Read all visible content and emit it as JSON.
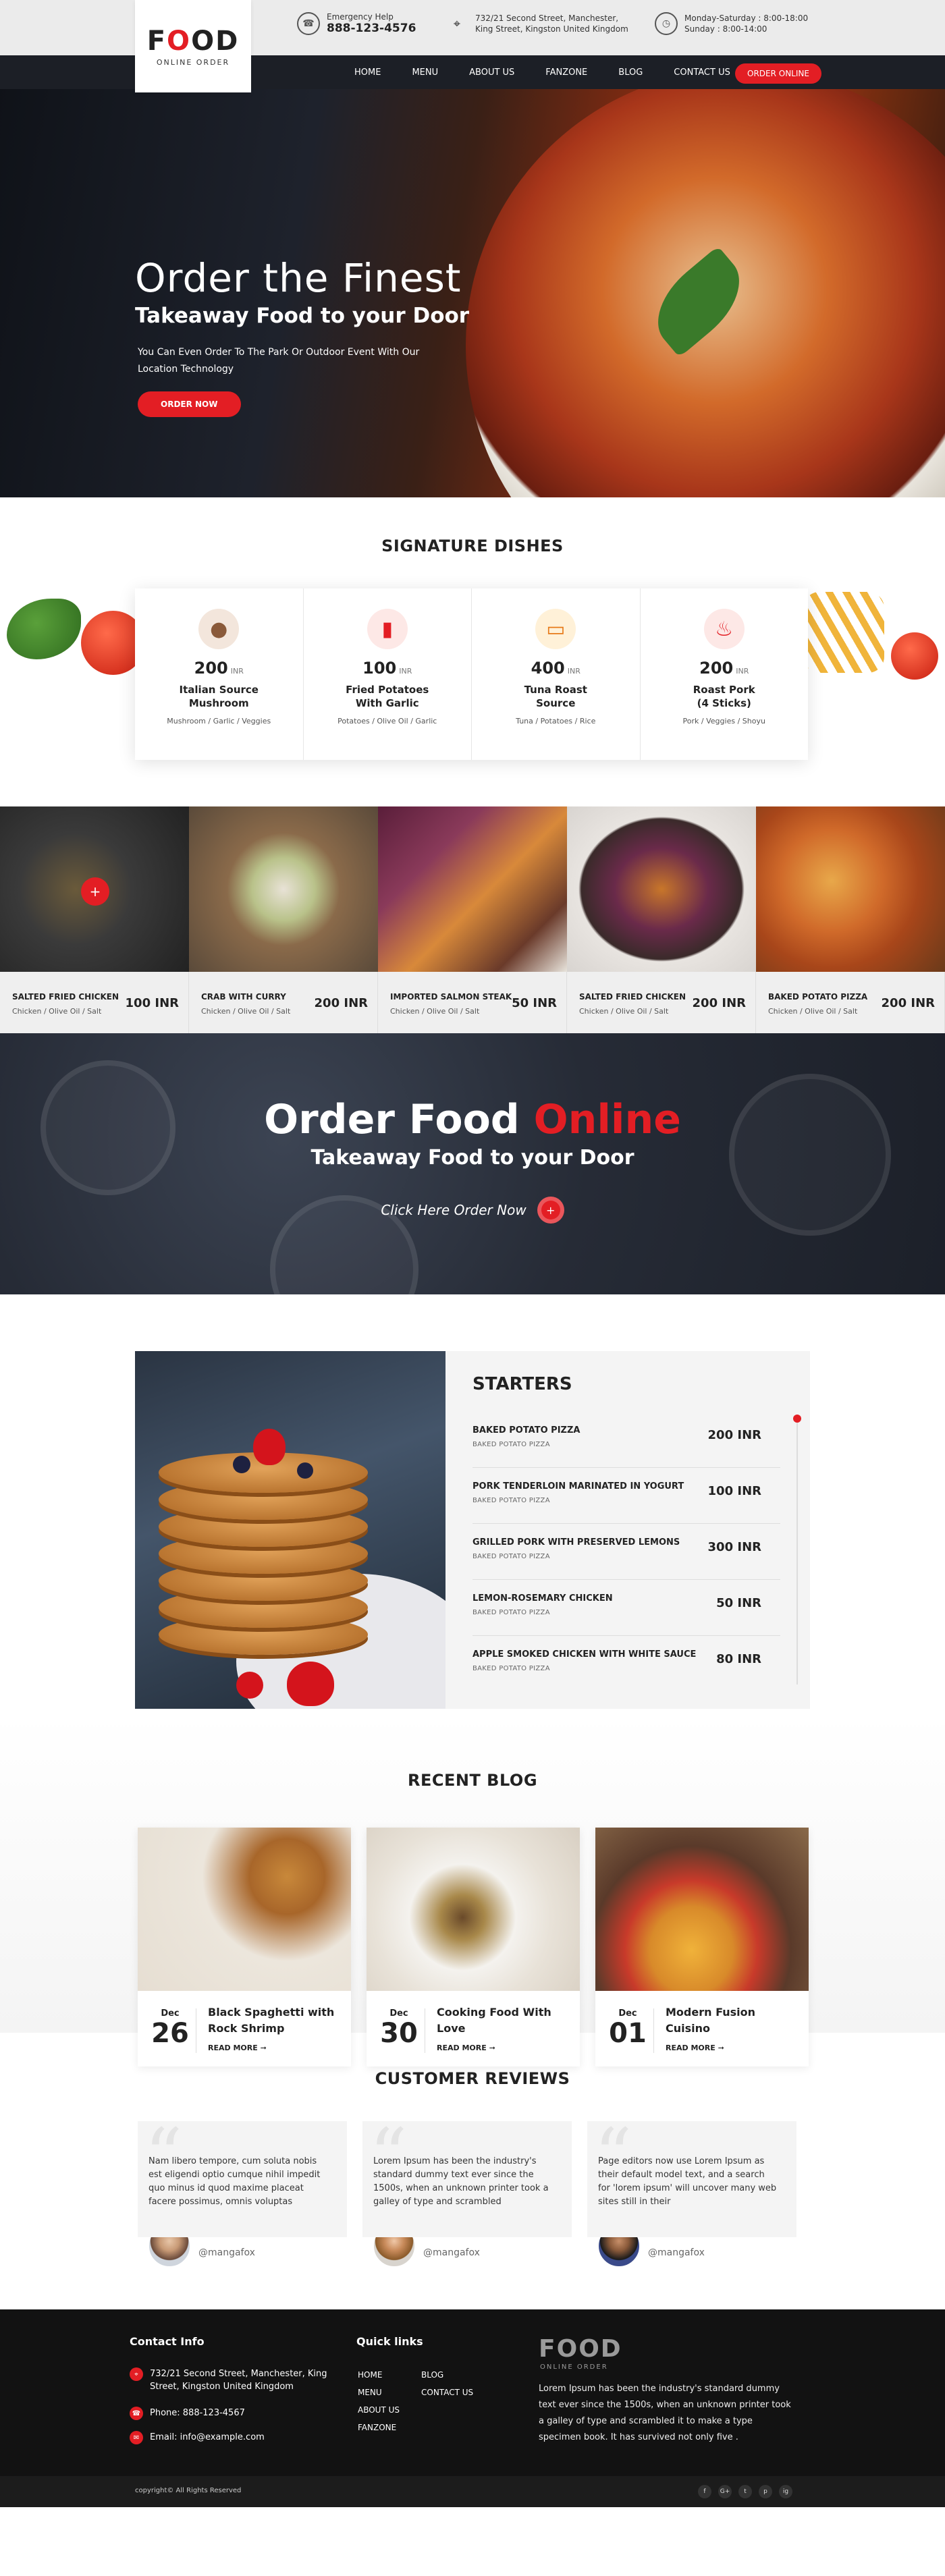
{
  "header": {
    "logo_main": "FOOD",
    "logo_sub": "ONLINE ORDER",
    "emergency_label": "Emergency Help",
    "emergency_phone": "888-123-4576",
    "address_line1": "732/21 Second Street, Manchester,",
    "address_line2": "King Street, Kingston United Kingdom",
    "hours_line1": "Monday-Saturday : 8:00-18:00",
    "hours_line2": "Sunday : 8:00-14:00"
  },
  "nav": {
    "items": [
      "HOME",
      "MENU",
      "ABOUT US",
      "FANZONE",
      "BLOG",
      "CONTACT US"
    ],
    "order_button": "ORDER ONLINE"
  },
  "hero": {
    "title": "Order the Finest",
    "subtitle": "Takeaway Food to your Door",
    "text": "You Can Even Order To The Park Or Outdoor Event With Our Location Technology",
    "button": "ORDER NOW"
  },
  "signature": {
    "title": "SIGNATURE DISHES",
    "currency": "INR",
    "dishes": [
      {
        "price": "200",
        "name_1": "Italian Source",
        "name_2": "Mushroom",
        "ingredients": "Mushroom / Garlic / Veggies",
        "icon": "mushroom-icon"
      },
      {
        "price": "100",
        "name_1": "Fried Potatoes",
        "name_2": "With Garlic",
        "ingredients": "Potatoes / Olive Oil / Garlic",
        "icon": "fries-drink-icon"
      },
      {
        "price": "400",
        "name_1": "Tuna Roast",
        "name_2": "Source",
        "ingredients": "Tuna / Potatoes / Rice",
        "icon": "sushi-icon"
      },
      {
        "price": "200",
        "name_1": "Roast Pork",
        "name_2": "(4 Sticks)",
        "ingredients": "Pork / Veggies / Shoyu",
        "icon": "roast-pork-icon"
      }
    ]
  },
  "gallery": [
    {
      "name": "SALTED FRIED CHICKEN",
      "sub": "Chicken / Olive Oil / Salt",
      "price": "100 INR"
    },
    {
      "name": "CRAB WITH CURRY",
      "sub": "Chicken / Olive Oil / Salt",
      "price": "200 INR"
    },
    {
      "name": "IMPORTED SALMON STEAK",
      "sub": "Chicken / Olive Oil / Salt",
      "price": "50 INR"
    },
    {
      "name": "SALTED FRIED CHICKEN",
      "sub": "Chicken / Olive Oil / Salt",
      "price": "200 INR"
    },
    {
      "name": "BAKED POTATO PIZZA",
      "sub": "Chicken / Olive Oil / Salt",
      "price": "200 INR"
    }
  ],
  "banner": {
    "title_white": "Order Food",
    "title_red": "Online",
    "subtitle": "Takeaway Food to your Door",
    "cta": "Click Here Order Now"
  },
  "menu": {
    "title": "STARTERS",
    "items": [
      {
        "name": "BAKED POTATO PIZZA",
        "sub": "BAKED POTATO PIZZA",
        "price": "200 INR"
      },
      {
        "name": "PORK TENDERLOIN MARINATED IN YOGURT",
        "sub": "BAKED POTATO PIZZA",
        "price": "100 INR"
      },
      {
        "name": "GRILLED PORK WITH PRESERVED LEMONS",
        "sub": "BAKED POTATO PIZZA",
        "price": "300 INR"
      },
      {
        "name": "LEMON-ROSEMARY CHICKEN",
        "sub": "BAKED POTATO PIZZA",
        "price": "50 INR"
      },
      {
        "name": "APPLE SMOKED CHICKEN WITH WHITE SAUCE",
        "sub": "BAKED POTATO PIZZA",
        "price": "80 INR"
      }
    ]
  },
  "blog": {
    "title": "RECENT BLOG",
    "read_more": "READ MORE",
    "posts": [
      {
        "month": "Dec",
        "day": "26",
        "title": "Black Spaghetti with Rock Shrimp"
      },
      {
        "month": "Dec",
        "day": "30",
        "title": "Cooking Food With Love"
      },
      {
        "month": "Dec",
        "day": "01",
        "title": "Modern Fusion Cuisino"
      }
    ]
  },
  "reviews": {
    "title": "CUSTOMER REVIEWS",
    "items": [
      {
        "text": "Nam libero tempore, cum soluta nobis est eligendi optio cumque nihil impedit quo minus id quod maxime placeat facere possimus, omnis voluptas",
        "handle": "@mangafox"
      },
      {
        "text": "Lorem Ipsum has been the industry's standard dummy text ever since the 1500s, when an unknown printer took a galley of type and scrambled",
        "handle": "@mangafox"
      },
      {
        "text": "Page editors now use Lorem Ipsum as their default model text, and a search for 'lorem ipsum' will uncover many web sites still in their",
        "handle": "@mangafox"
      }
    ]
  },
  "footer": {
    "contact_title": "Contact Info",
    "address": "732/21 Second Street, Manchester, King Street, Kingston United Kingdom",
    "phone": "Phone: 888-123-4567",
    "email": "Email: info@example.com",
    "links_title": "Quick links",
    "links_col1": [
      "HOME",
      "MENU",
      "ABOUT US",
      "FANZONE"
    ],
    "links_col2": [
      "BLOG",
      "CONTACT US"
    ],
    "logo_main": "FOOD",
    "logo_sub": "ONLINE ORDER",
    "about": "Lorem Ipsum has been the industry's standard dummy text ever since the 1500s, when an unknown printer took a galley of type and scrambled it to make a type specimen book. It has survived not only five .",
    "copyright": "copyright© All Rights Reserved",
    "social": [
      "f",
      "G+",
      "t",
      "p",
      "ig"
    ]
  },
  "colors": {
    "accent": "#e31e24",
    "dark": "#1c1f26"
  }
}
